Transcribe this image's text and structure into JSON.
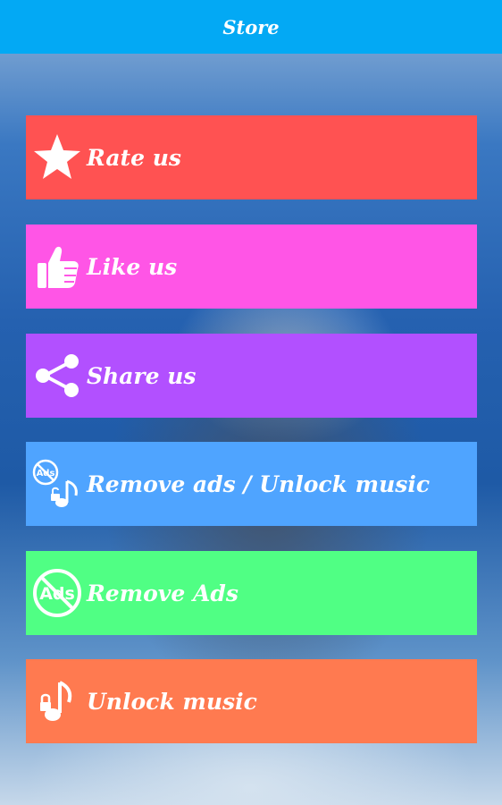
{
  "header": {
    "title": "Store"
  },
  "menu": [
    {
      "label": "Rate us",
      "icon": "star-icon",
      "color": "#ff5252"
    },
    {
      "label": "Like us",
      "icon": "thumbs-up-icon",
      "color": "#ff55e6"
    },
    {
      "label": "Share us",
      "icon": "share-icon",
      "color": "#b250ff"
    },
    {
      "label": "Remove ads / Unlock music",
      "icon": "remove-ads-unlock-music-icon",
      "color": "#4fa4ff"
    },
    {
      "label": "Remove Ads",
      "icon": "no-ads-icon",
      "color": "#50ff84"
    },
    {
      "label": "Unlock music",
      "icon": "music-lock-icon",
      "color": "#ff7a50"
    }
  ],
  "icon_text": {
    "ads": "Ads"
  }
}
